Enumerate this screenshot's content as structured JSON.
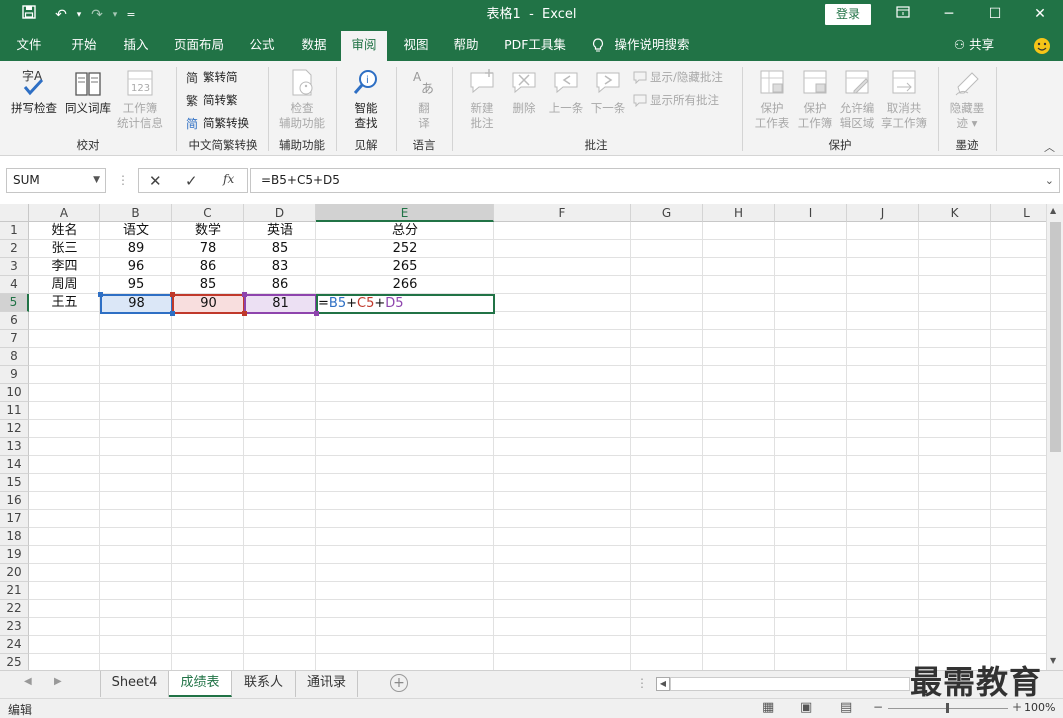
{
  "title": {
    "doc_name": "表格1",
    "separator": "-",
    "app_name": "Excel",
    "login_label": "登录",
    "quick_access_extra": "="
  },
  "tabs": [
    "文件",
    "开始",
    "插入",
    "页面布局",
    "公式",
    "数据",
    "审阅",
    "视图",
    "帮助",
    "PDF工具集",
    "操作说明搜索"
  ],
  "active_tab": "审阅",
  "share_label": "共享",
  "ribbon": {
    "proofing": {
      "spell": "拼写检查",
      "thesaurus": "同义词库",
      "stats_line1": "工作簿",
      "stats_line2": "统计信息",
      "group": "校对"
    },
    "chinese": {
      "t2s": "繁转简",
      "s2t": "简转繁",
      "convert": "简繁转换",
      "group": "中文简繁转换"
    },
    "accessibility": {
      "line1": "检查",
      "line2": "辅助功能",
      "group": "辅助功能"
    },
    "insights": {
      "line1": "智能",
      "line2": "查找",
      "group": "见解"
    },
    "language": {
      "line1": "翻",
      "line2": "译",
      "group": "语言"
    },
    "comments": {
      "new1": "新建",
      "new2": "批注",
      "delete": "删除",
      "prev": "上一条",
      "next": "下一条",
      "show_hide": "显示/隐藏批注",
      "show_all": "显示所有批注",
      "group": "批注"
    },
    "protect": {
      "sheet1": "保护",
      "sheet2": "工作表",
      "wb1": "保护",
      "wb2": "工作簿",
      "allow1": "允许编",
      "allow2": "辑区域",
      "unshare1": "取消共",
      "unshare2": "享工作簿",
      "group": "保护"
    },
    "ink": {
      "line1": "隐藏墨",
      "line2": "迹 ▾",
      "group": "墨迹"
    }
  },
  "namebox": "SUM",
  "formula": "=B5+C5+D5",
  "fx_label": "fx",
  "columns": [
    "A",
    "B",
    "C",
    "D",
    "E",
    "F",
    "G",
    "H",
    "I",
    "J",
    "K",
    "L"
  ],
  "rows": [
    "1",
    "2",
    "3",
    "4",
    "5",
    "6",
    "7",
    "8",
    "9",
    "10",
    "11",
    "12",
    "13",
    "14",
    "15",
    "16",
    "17",
    "18",
    "19",
    "20",
    "21",
    "22",
    "23",
    "24",
    "25"
  ],
  "table": [
    [
      "姓名",
      "语文",
      "数学",
      "英语",
      "总分"
    ],
    [
      "张三",
      "89",
      "78",
      "85",
      "252"
    ],
    [
      "李四",
      "96",
      "86",
      "83",
      "265"
    ],
    [
      "周周",
      "95",
      "85",
      "86",
      "266"
    ],
    [
      "王五",
      "98",
      "90",
      "81",
      ""
    ]
  ],
  "edit_formula": {
    "eq": "=",
    "b": "B5",
    "p1": "+",
    "c": "C5",
    "p2": "+",
    "d": "D5"
  },
  "sheets": [
    "Sheet4",
    "成绩表",
    "联系人",
    "通讯录"
  ],
  "active_sheet": "成绩表",
  "status": {
    "mode": "编辑",
    "zoom": "100%"
  },
  "watermark": "最需教育",
  "colors": {
    "brand": "#217346",
    "ref_b": "#2e6fc4",
    "ref_c": "#c0392b",
    "ref_d": "#8e44ad"
  }
}
